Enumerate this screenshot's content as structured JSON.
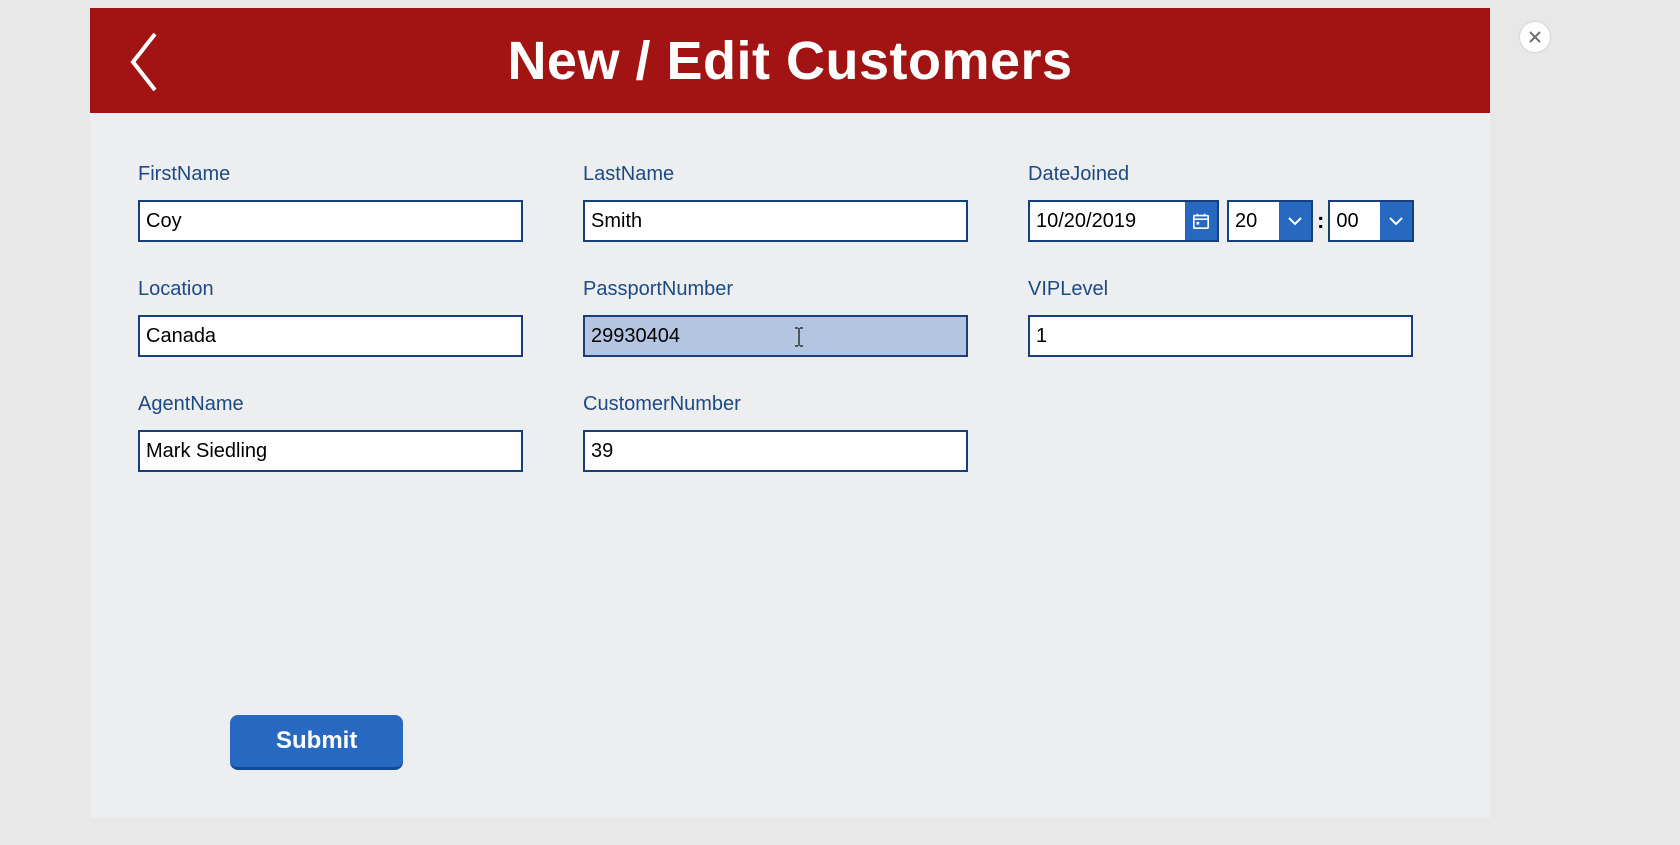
{
  "header": {
    "title": "New / Edit Customers"
  },
  "form": {
    "firstName": {
      "label": "FirstName",
      "value": "Coy"
    },
    "lastName": {
      "label": "LastName",
      "value": "Smith"
    },
    "dateJoined": {
      "label": "DateJoined",
      "date": "10/20/2019",
      "hour": "20",
      "minute": "00",
      "separator": ":"
    },
    "location": {
      "label": "Location",
      "value": "Canada"
    },
    "passportNumber": {
      "label": "PassportNumber",
      "value": "29930404"
    },
    "vipLevel": {
      "label": "VIPLevel",
      "value": "1"
    },
    "agentName": {
      "label": "AgentName",
      "value": "Mark Siedling"
    },
    "customerNumber": {
      "label": "CustomerNumber",
      "value": "39"
    }
  },
  "buttons": {
    "submit": "Submit"
  }
}
